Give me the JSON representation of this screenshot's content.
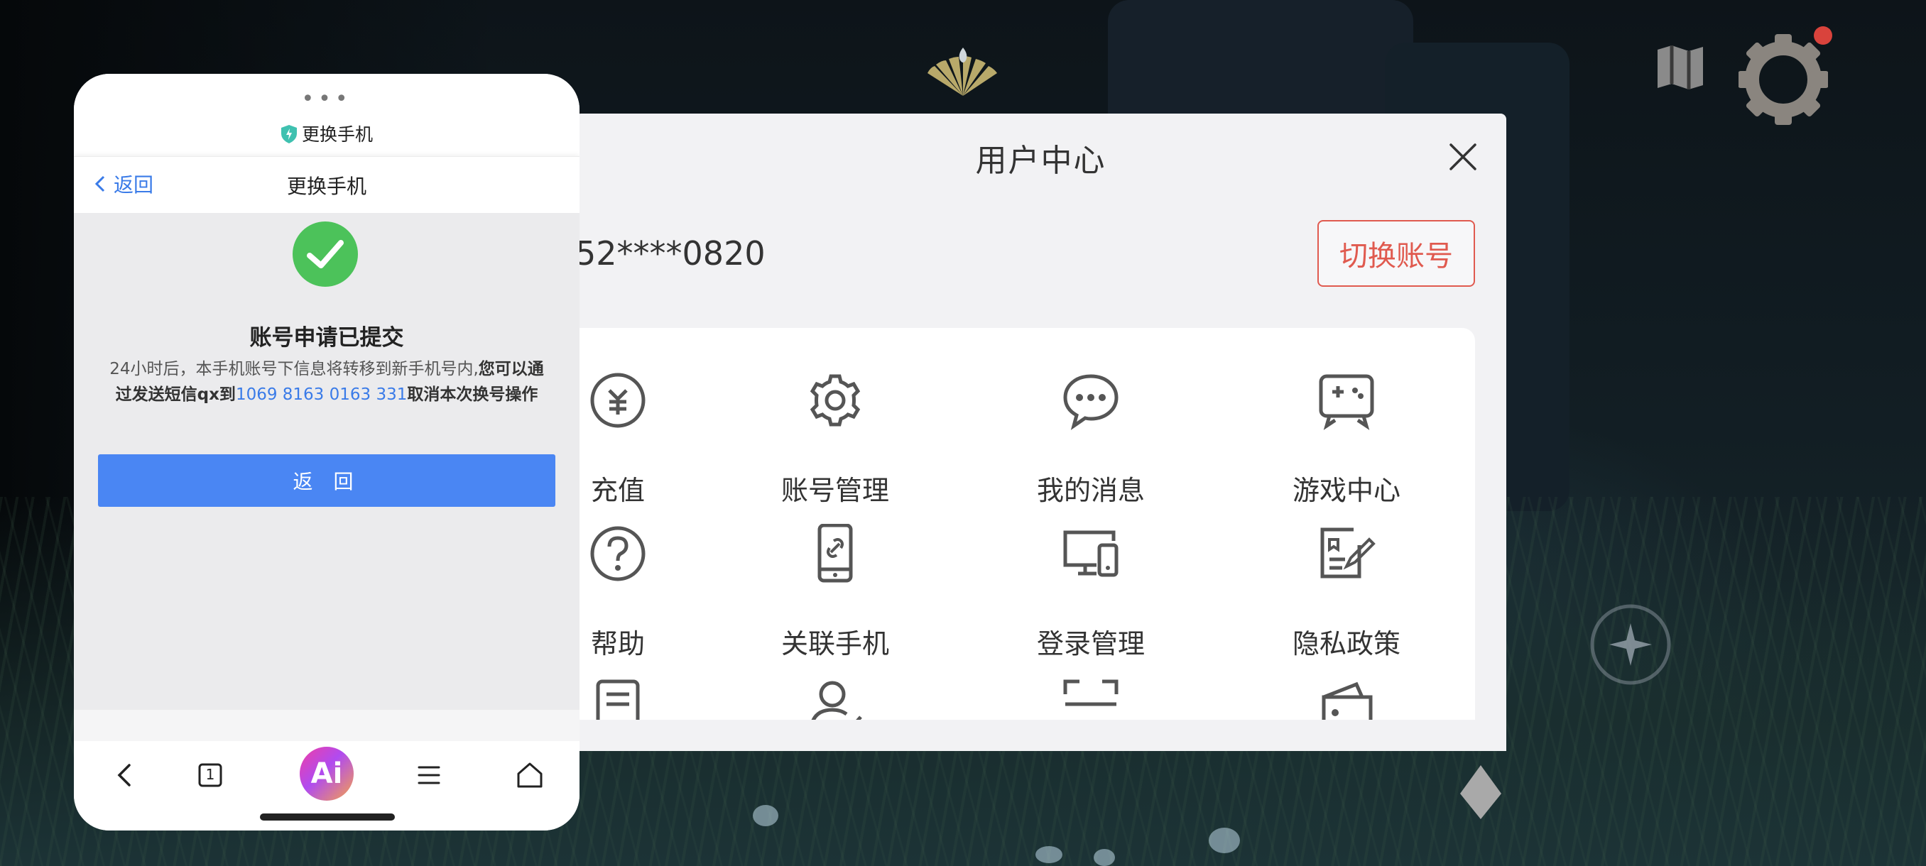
{
  "user_center": {
    "title": "用户中心",
    "account_masked": "52****0820",
    "switch_account_label": "切换账号",
    "grid": [
      {
        "label": "充值",
        "icon": "recharge-icon"
      },
      {
        "label": "账号管理",
        "icon": "gear-icon"
      },
      {
        "label": "我的消息",
        "icon": "chat-bubble-icon"
      },
      {
        "label": "游戏中心",
        "icon": "gamepad-icon"
      },
      {
        "label": "帮助",
        "icon": "help-icon"
      },
      {
        "label": "关联手机",
        "icon": "phone-link-icon"
      },
      {
        "label": "登录管理",
        "icon": "devices-icon"
      },
      {
        "label": "隐私政策",
        "icon": "privacy-doc-icon"
      }
    ]
  },
  "phone": {
    "window_title": "更换手机",
    "nav": {
      "back_label": "返回",
      "title": "更换手机"
    },
    "result": {
      "title": "账号申请已提交",
      "body_plain": "24小时后，本手机账号下信息将转移到新手机号内,",
      "body_bold_1": "您可以通过发送短信qx到",
      "body_number": "1069 8163 0163 331",
      "body_bold_2": "取消本次换号操作"
    },
    "return_button": "返 回",
    "ai_label": "Ai",
    "tab_count": "1"
  },
  "colors": {
    "accent_blue": "#4a86f3",
    "link_blue": "#3a7be8",
    "switch_red": "#e05a4f",
    "success_green": "#4cc25a",
    "badge_red": "#e0322a"
  }
}
